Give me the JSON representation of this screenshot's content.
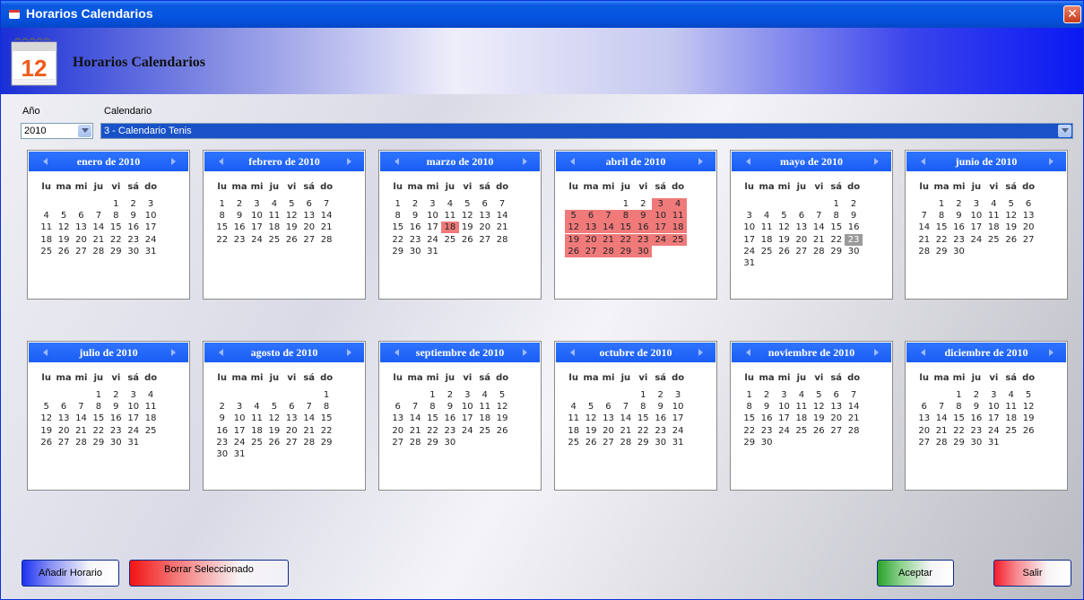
{
  "window": {
    "title": "Horarios Calendarios",
    "close_glyph": "✕"
  },
  "banner": {
    "title": "Horarios Calendarios",
    "icon_number": "12"
  },
  "filters": {
    "year_label": "Año",
    "year_value": "2010",
    "calendar_label": "Calendario",
    "calendar_value": "3 - Calendario Tenis"
  },
  "weekdays": [
    "lu",
    "ma",
    "mi",
    "ju",
    "vi",
    "sá",
    "do"
  ],
  "months": [
    {
      "title": "enero de 2010",
      "first_weekday": 4,
      "days": 31,
      "highlighted": [],
      "today": null
    },
    {
      "title": "febrero de 2010",
      "first_weekday": 0,
      "days": 28,
      "highlighted": [],
      "today": null
    },
    {
      "title": "marzo de 2010",
      "first_weekday": 0,
      "days": 31,
      "highlighted": [
        18
      ],
      "today": null
    },
    {
      "title": "abril de 2010",
      "first_weekday": 3,
      "days": 30,
      "highlighted": [
        3,
        4,
        5,
        6,
        7,
        8,
        9,
        10,
        11,
        12,
        13,
        14,
        15,
        16,
        17,
        18,
        19,
        20,
        21,
        22,
        23,
        24,
        25,
        26,
        27,
        28,
        29,
        30
      ],
      "today": null
    },
    {
      "title": "mayo de 2010",
      "first_weekday": 5,
      "days": 31,
      "highlighted": [],
      "today": 23
    },
    {
      "title": "junio de 2010",
      "first_weekday": 1,
      "days": 30,
      "highlighted": [],
      "today": null
    },
    {
      "title": "julio de 2010",
      "first_weekday": 3,
      "days": 31,
      "highlighted": [],
      "today": null
    },
    {
      "title": "agosto de 2010",
      "first_weekday": 6,
      "days": 31,
      "highlighted": [],
      "today": null
    },
    {
      "title": "septiembre de 2010",
      "first_weekday": 2,
      "days": 30,
      "highlighted": [],
      "today": null
    },
    {
      "title": "octubre de 2010",
      "first_weekday": 4,
      "days": 31,
      "highlighted": [],
      "today": null
    },
    {
      "title": "noviembre de 2010",
      "first_weekday": 0,
      "days": 30,
      "highlighted": [],
      "today": null
    },
    {
      "title": "diciembre de 2010",
      "first_weekday": 2,
      "days": 31,
      "highlighted": [],
      "today": null
    }
  ],
  "colors": {
    "highlight": "#f07a7a",
    "today": "#9a9a9a",
    "month_header": "#1a5df4"
  },
  "buttons": {
    "add": "Añadir Horario",
    "delete": "Borrar Seleccionado",
    "accept": "Aceptar",
    "exit": "Salir"
  }
}
